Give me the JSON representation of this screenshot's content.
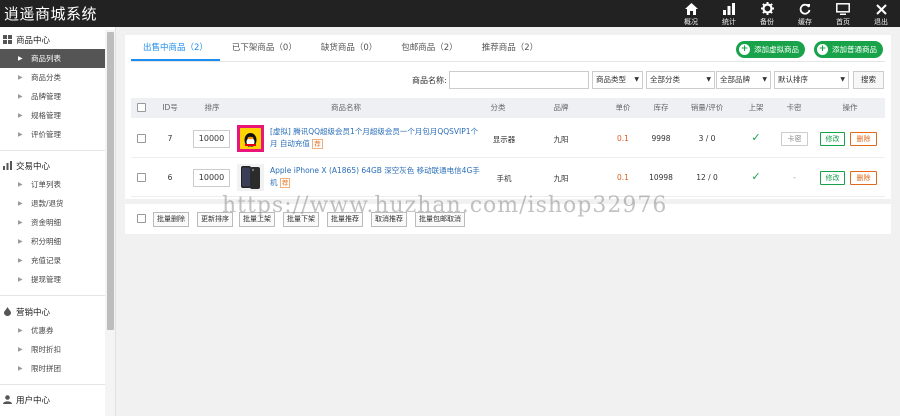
{
  "app": {
    "title": "逍遥商城系统"
  },
  "topnav": [
    {
      "label": "概况",
      "icon": "home-icon"
    },
    {
      "label": "统计",
      "icon": "bar-chart-icon"
    },
    {
      "label": "备份",
      "icon": "gear-icon"
    },
    {
      "label": "缓存",
      "icon": "refresh-icon"
    },
    {
      "label": "首页",
      "icon": "monitor-icon"
    },
    {
      "label": "退出",
      "icon": "close-icon"
    }
  ],
  "sidebar": {
    "groups": [
      {
        "title": "商品中心",
        "icon": "grid-icon",
        "items": [
          "商品列表",
          "商品分类",
          "品牌管理",
          "规格管理",
          "评价管理"
        ],
        "active": 0
      },
      {
        "title": "交易中心",
        "icon": "bar-chart-icon",
        "items": [
          "订单列表",
          "退款/退货",
          "资金明细",
          "积分明细",
          "充值记录",
          "提现管理"
        ]
      },
      {
        "title": "营销中心",
        "icon": "flame-icon",
        "items": [
          "优惠券",
          "限时折扣",
          "限时拼团"
        ]
      },
      {
        "title": "用户中心",
        "icon": "user-icon",
        "items": []
      }
    ]
  },
  "tabs": [
    {
      "label": "出售中商品（2）",
      "active": true
    },
    {
      "label": "已下架商品（0）"
    },
    {
      "label": "缺货商品（0）"
    },
    {
      "label": "包邮商品（2）"
    },
    {
      "label": "推荐商品（2）"
    }
  ],
  "actions": {
    "add_virtual": "添加虚拟商品",
    "add_normal": "添加普通商品"
  },
  "filter": {
    "name_label": "商品名称:",
    "name_value": "",
    "type_select": "商品类型",
    "category_select": "全部分类",
    "brand_select": "全部品牌",
    "sort_select": "默认排序",
    "search_button": "搜索"
  },
  "table": {
    "columns": [
      "ID号",
      "排序",
      "商品名称",
      "分类",
      "品牌",
      "单价",
      "库存",
      "销量/评价",
      "上架",
      "卡密",
      "操作"
    ],
    "rows": [
      {
        "id": "7",
        "sort": "10000",
        "name": "[虚拟] 腾讯QQ超级会员1个月超级会员一个月包月QQSVIP1个月 自动充值",
        "tag": "荐",
        "category": "显示器",
        "brand": "九阳",
        "price": "0.1",
        "stock": "9998",
        "sales": "3 / 0",
        "onsale": "✓",
        "card": "卡密",
        "edit": "修改",
        "delete": "删除",
        "thumb": "qq"
      },
      {
        "id": "6",
        "sort": "10000",
        "name": "Apple iPhone X (A1865) 64GB 深空灰色 移动联通电信4G手机",
        "tag": "荐",
        "category": "手机",
        "brand": "九阳",
        "price": "0.1",
        "stock": "10998",
        "sales": "12 / 0",
        "onsale": "✓",
        "card": "-",
        "edit": "修改",
        "delete": "删除",
        "thumb": "iphone"
      }
    ]
  },
  "bulk": [
    "批量删除",
    "更新排序",
    "批量上架",
    "批量下架",
    "批量推荐",
    "取消推荐",
    "批量包邮取消"
  ],
  "watermark": "https://www.huzhan.com/ishop32976",
  "colors": {
    "accent": "#1d8cf0",
    "green": "#18a34a",
    "orange": "#e06b1c",
    "topbar": "#222222"
  }
}
